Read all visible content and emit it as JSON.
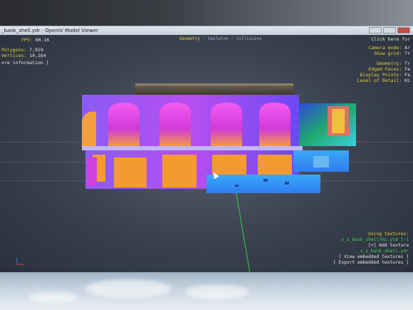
{
  "window": {
    "title": "_bank_shell.ydr - OpenIV Model Viewer"
  },
  "tabs": {
    "active": "Geometry",
    "separator": "|",
    "items": [
      "Geometry",
      "Skeleton",
      "Collisions"
    ]
  },
  "stats": {
    "fps_label": "FPS:",
    "fps_value": "60.16",
    "polygons_label": "Polygons:",
    "polygons_value": "7,919",
    "vertices_label": "Vertices:",
    "vertices_value": "10,164",
    "more_info": "ore information ]"
  },
  "right_info": {
    "hint": "Click here for",
    "camera_label": "Camera mode:",
    "camera_value": "Ar",
    "grid_label": "Show grid:",
    "grid_value": "Tr",
    "geometry_label": "Geometry:",
    "geometry_value": "Tr",
    "edged_label": "Edged Faces:",
    "edged_value": "Fa",
    "display_points_label": "Display Points:",
    "display_points_value": "Fa",
    "lod_label": "Level of Detail:",
    "lod_value": "Hi"
  },
  "textures": {
    "title": "Using textures:",
    "items": [
      "v_s_bank_shell+hi.ytd [-]",
      "[+] Add texture",
      "v_s_bank_shell.ydr"
    ],
    "view_button": "[ View embedded textures ]",
    "export_button": "[ Export embedded textures ]"
  },
  "colors": {
    "hud_yellow": "#e6d23a",
    "hud_green": "#3fd94a",
    "axis_green": "#2fd14a",
    "facade_magenta": "#d43cf0",
    "facade_violet": "#7a4cf2",
    "facade_orange": "#f0932f",
    "facade_blue": "#2f86f5",
    "facade_cyan": "#2fb6f5"
  }
}
